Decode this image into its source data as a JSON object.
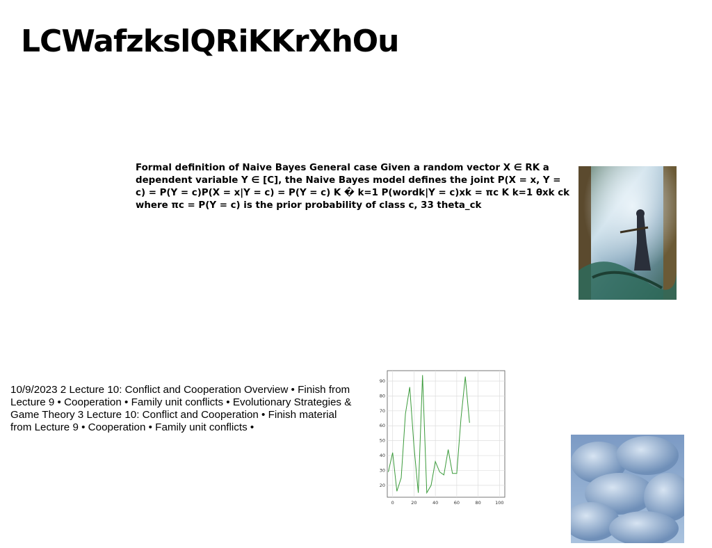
{
  "title": "LCWafzkslQRiKKrXhOu",
  "naive_bayes_text": "Formal definition of Naive Bayes General case Given a random vector X ∈ RK a dependent variable Y ∈ [C], the Naive Bayes model defines the joint P(X = x, Y = c) = P(Y = c)P(X = x|Y = c) = P(Y = c) K � k=1 P(wordk|Y = c)xk = πc K k=1 θxk ck where πc = P(Y = c) is the prior probability of class c, 33 theta_ck",
  "lecture_text": "10/9/2023 2 Lecture 10: Conflict and Cooperation Overview • Finish from Lecture 9 • Cooperation • Family unit conflicts • Evolutionary Strategies & Game Theory 3 Lecture 10: Conflict and Cooperation • Finish material from Lecture 9 • Cooperation • Family unit conflicts •",
  "chart_data": {
    "type": "line",
    "title": "",
    "xlabel": "",
    "ylabel": "",
    "xlim": [
      -5,
      105
    ],
    "ylim": [
      12,
      97
    ],
    "grid": true,
    "color": "#3a9a3a",
    "xticks": [
      0,
      20,
      40,
      60,
      80,
      100
    ],
    "yticks": [
      20,
      30,
      40,
      50,
      60,
      70,
      80,
      90
    ],
    "x": [
      -4,
      0,
      4,
      8,
      12,
      16,
      20,
      24,
      28,
      32,
      36,
      40,
      44,
      48,
      52,
      56,
      60,
      64,
      68,
      72,
      76,
      80,
      84,
      88,
      92,
      96,
      100
    ],
    "y": [
      29,
      42,
      16,
      25,
      68,
      86,
      46,
      15,
      94,
      15,
      20,
      36,
      29,
      27,
      44,
      28,
      28,
      65,
      93,
      62,
      null,
      null,
      null,
      null,
      null,
      null,
      null
    ]
  }
}
